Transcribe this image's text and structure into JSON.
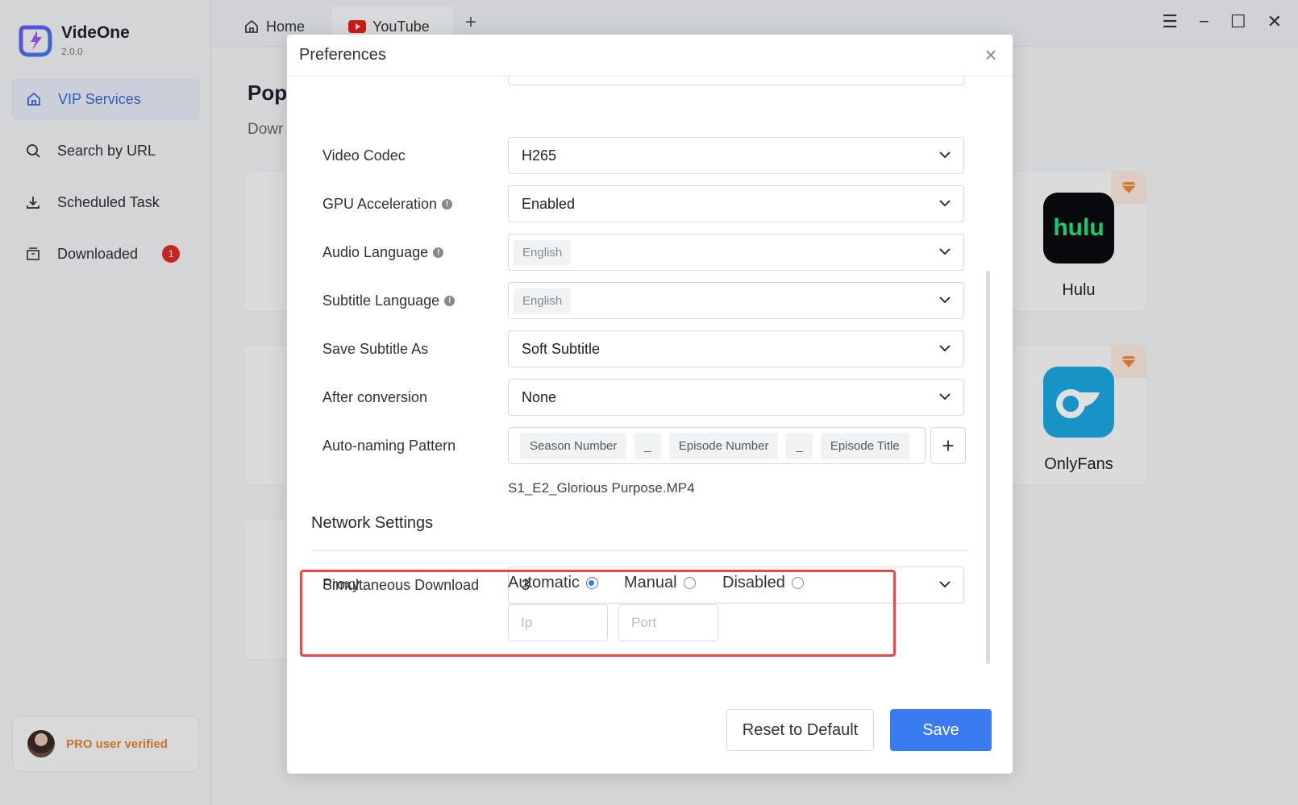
{
  "app": {
    "name": "VideOne",
    "version": "2.0.0"
  },
  "sidebar": {
    "items": [
      {
        "label": "VIP Services",
        "icon": "home-icon",
        "active": true
      },
      {
        "label": "Search by URL",
        "icon": "search-icon"
      },
      {
        "label": "Scheduled Task",
        "icon": "download-icon"
      },
      {
        "label": "Downloaded",
        "icon": "archive-icon",
        "badge": "1"
      }
    ],
    "pro_text": "PRO user verified"
  },
  "tabs": [
    {
      "label": "Home",
      "icon": "home-icon"
    },
    {
      "label": "YouTube",
      "icon": "youtube-icon"
    }
  ],
  "main": {
    "title": "Pop",
    "subtitle": "Dowr",
    "services": [
      {
        "name": "Hulu",
        "logo_text": "hulu",
        "color": "#000000",
        "text_color": "#1ce783"
      },
      {
        "name": "OnlyFans",
        "color": "#1ba8e2"
      }
    ]
  },
  "modal": {
    "title": "Preferences",
    "settings": [
      {
        "label": "Video Codec",
        "value": "H265",
        "info": false
      },
      {
        "label": "GPU Acceleration",
        "value": "Enabled",
        "info": true
      },
      {
        "label": "Audio Language",
        "value": "English",
        "info": true,
        "tag": true
      },
      {
        "label": "Subtitle Language",
        "value": "English",
        "info": true,
        "tag": true
      },
      {
        "label": "Save Subtitle As",
        "value": "Soft Subtitle",
        "info": false
      },
      {
        "label": "After conversion",
        "value": "None",
        "info": false
      }
    ],
    "naming": {
      "label": "Auto-naming Pattern",
      "tags": [
        "Season Number",
        "_",
        "Episode Number",
        "_",
        "Episode Title"
      ],
      "preview": "S1_E2_Glorious Purpose.MP4"
    },
    "network": {
      "title": "Network Settings",
      "simultaneous_label": "Simultaneous Download",
      "simultaneous_value": "3",
      "proxy_label": "Proxy",
      "proxy_options": [
        "Automatic",
        "Manual",
        "Disabled"
      ],
      "proxy_selected": "Automatic",
      "ip_placeholder": "Ip",
      "port_placeholder": "Port"
    },
    "buttons": {
      "reset": "Reset to Default",
      "save": "Save"
    }
  },
  "colors": {
    "accent": "#3a7cf0",
    "highlight": "#e94848",
    "pro": "#e0852e"
  }
}
